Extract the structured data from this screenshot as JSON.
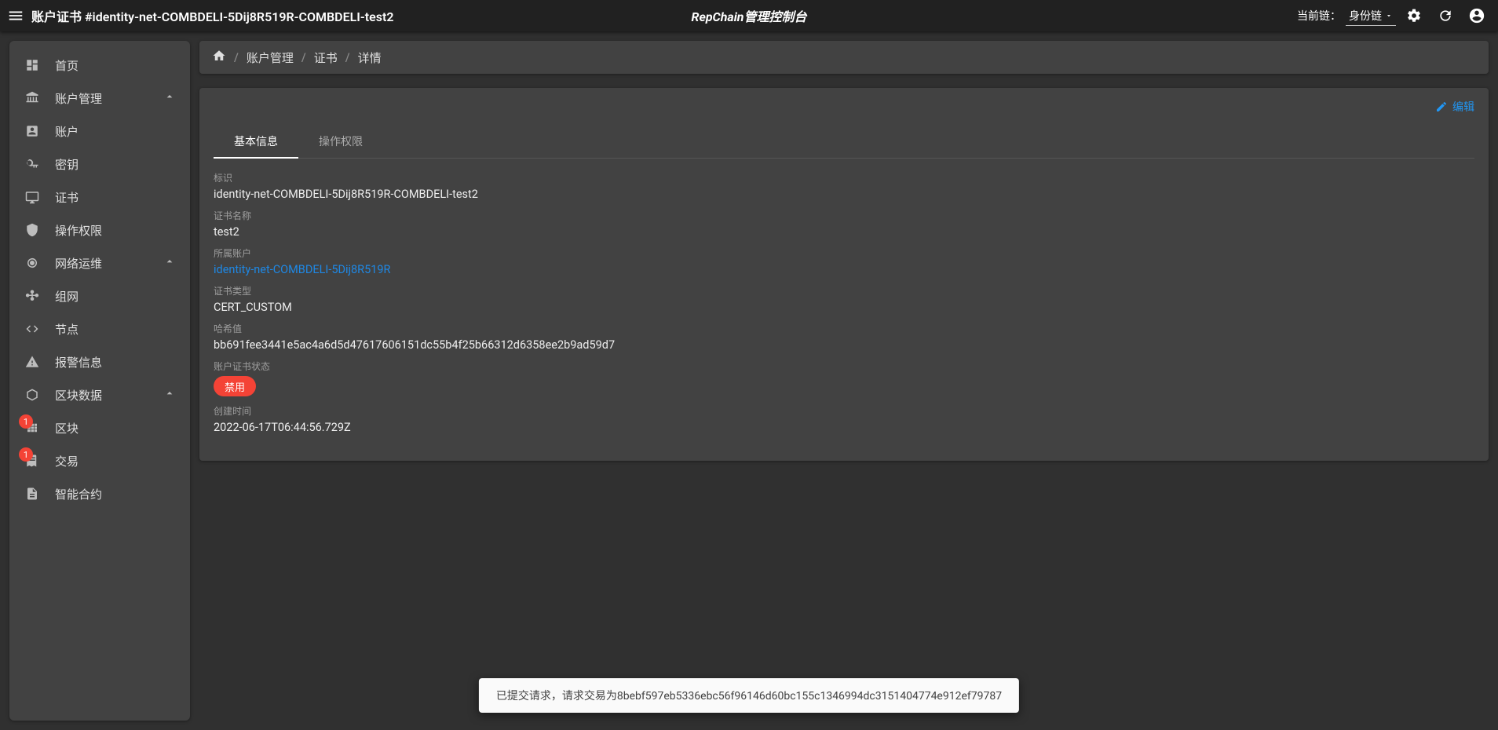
{
  "topbar": {
    "title": "账户证书 #identity-net-COMBDELI-5Dij8R519R-COMBDELI-test2",
    "center_title": "RepChain管理控制台",
    "chain_label": "当前链：",
    "chain_value": "身份链"
  },
  "sidebar": {
    "home": "首页",
    "account_mgmt": "账户管理",
    "account": "账户",
    "key": "密钥",
    "cert": "证书",
    "perm": "操作权限",
    "netops": "网络运维",
    "network": "组网",
    "node": "节点",
    "alert": "报警信息",
    "blockdata": "区块数据",
    "block": "区块",
    "tx": "交易",
    "contract": "智能合约",
    "badge_block": "1",
    "badge_tx": "1"
  },
  "breadcrumb": {
    "l1": "账户管理",
    "l2": "证书",
    "l3": "详情"
  },
  "actions": {
    "edit": "编辑"
  },
  "tabs": {
    "basic": "基本信息",
    "perm": "操作权限"
  },
  "detail": {
    "id_label": "标识",
    "id_value": "identity-net-COMBDELI-5Dij8R519R-COMBDELI-test2",
    "certname_label": "证书名称",
    "certname_value": "test2",
    "owner_label": "所属账户",
    "owner_value": "identity-net-COMBDELI-5Dij8R519R",
    "certtype_label": "证书类型",
    "certtype_value": "CERT_CUSTOM",
    "hash_label": "哈希值",
    "hash_value": "bb691fee3441e5ac4a6d5d47617606151dc55b4f25b66312d6358ee2b9ad59d7",
    "status_label": "账户证书状态",
    "status_value": "禁用",
    "created_label": "创建时间",
    "created_value": "2022-06-17T06:44:56.729Z"
  },
  "snackbar": "已提交请求，请求交易为8bebf597eb5336ebc56f96146d60bc155c1346994dc3151404774e912ef79787"
}
